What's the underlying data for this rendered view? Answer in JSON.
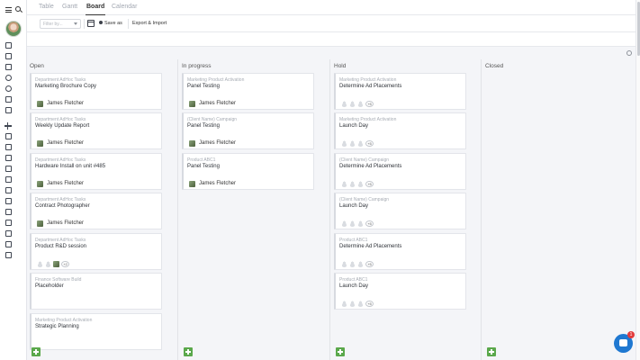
{
  "tabs": [
    {
      "label": "Table",
      "active": false
    },
    {
      "label": "Gantt",
      "active": false
    },
    {
      "label": "Board",
      "active": true
    },
    {
      "label": "Calendar",
      "active": false
    }
  ],
  "toolbar": {
    "filter_placeholder": "Filter by...",
    "save_label": "Save as",
    "export_label": "Export & Import"
  },
  "colors": {
    "accent": "#5aa84b",
    "chat": "#1f78d1",
    "badge": "#e23b3b"
  },
  "chat": {
    "badge_count": "1"
  },
  "board": {
    "columns": [
      {
        "title": "Open",
        "cards": [
          {
            "project": "Department AdHoc Tasks",
            "name": "Marketing Brochure Copy",
            "assignee": "James Fletcher"
          },
          {
            "project": "Department AdHoc Tasks",
            "name": "Weekly Update Report",
            "assignee": "James Fletcher"
          },
          {
            "project": "Department AdHoc Tasks",
            "name": "Hardware Install on unit #485",
            "assignee": "James Fletcher"
          },
          {
            "project": "Department AdHoc Tasks",
            "name": "Contract Photographer",
            "assignee": "James Fletcher"
          },
          {
            "project": "Department AdHoc Tasks",
            "name": "Product R&D session",
            "more": "+2"
          },
          {
            "project": "Finance Software Build",
            "name": "Placeholder"
          },
          {
            "project": "Marketing Product Activation",
            "name": "Strategic Planning"
          }
        ]
      },
      {
        "title": "In progress",
        "cards": [
          {
            "project": "Marketing Product Activation",
            "name": "Panel Testing",
            "assignee": "James Fletcher"
          },
          {
            "project": "(Client Name) Campaign",
            "name": "Panel Testing",
            "assignee": "James Fletcher"
          },
          {
            "project": "Product ABC1",
            "name": "Panel Testing",
            "assignee": "James Fletcher"
          }
        ]
      },
      {
        "title": "Hold",
        "cards": [
          {
            "project": "Marketing Product Activation",
            "name": "Determine Ad Placements",
            "more": "+5"
          },
          {
            "project": "Marketing Product Activation",
            "name": "Launch Day",
            "more": "+5"
          },
          {
            "project": "(Client Name) Campaign",
            "name": "Determine Ad Placements",
            "more": "+5"
          },
          {
            "project": "(Client Name) Campaign",
            "name": "Launch Day",
            "more": "+5"
          },
          {
            "project": "Product ABC1",
            "name": "Determine Ad Placements",
            "more": "+5"
          },
          {
            "project": "Product ABC1",
            "name": "Launch Day",
            "more": "+5"
          }
        ]
      },
      {
        "title": "Closed",
        "cards": []
      }
    ]
  }
}
